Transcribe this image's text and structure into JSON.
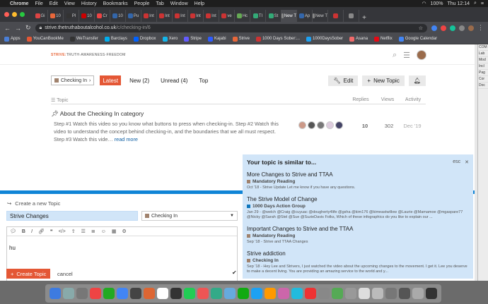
{
  "menubar": {
    "app": "Chrome",
    "items": [
      "File",
      "Edit",
      "View",
      "History",
      "Bookmarks",
      "People",
      "Tab",
      "Window",
      "Help"
    ],
    "battery": "100%",
    "clock": "Thu 12:14"
  },
  "tabs": [
    {
      "label": "Gi",
      "color": "#d44"
    },
    {
      "label": "10",
      "color": "#e8673a"
    },
    {
      "label": "Pl",
      "color": "#333"
    },
    {
      "label": "10",
      "color": "#c00"
    },
    {
      "label": "Cr",
      "color": "#e44"
    },
    {
      "label": "10",
      "color": "#36a"
    },
    {
      "label": "Pu",
      "color": "#36a"
    },
    {
      "label": "Int",
      "color": "#c33"
    },
    {
      "label": "Int",
      "color": "#c33"
    },
    {
      "label": "Int",
      "color": "#c33"
    },
    {
      "label": "Int",
      "color": "#c33"
    },
    {
      "label": "Int",
      "color": "#c33"
    },
    {
      "label": "ve",
      "color": "#c33"
    },
    {
      "label": "Hc",
      "color": "#6a5"
    },
    {
      "label": "TI",
      "color": "#3a7"
    },
    {
      "label": "St",
      "color": "#3a7"
    },
    {
      "label": "New T",
      "color": "#888"
    },
    {
      "label": "Ap",
      "color": "#36a"
    },
    {
      "label": "New T",
      "color": "#888"
    },
    {
      "label": "",
      "color": "#c33"
    },
    {
      "label": "",
      "color": "#888"
    }
  ],
  "address": {
    "domain": "strive.thetruthaboutalcohol.co.uk",
    "path": "/c/checking-in/6"
  },
  "bookmarks": [
    {
      "label": "Apps",
      "color": "#4a7fd8"
    },
    {
      "label": "YouCanBookMe",
      "color": "#e45735"
    },
    {
      "label": "WeTransfer",
      "color": "#333"
    },
    {
      "label": "Barclays",
      "color": "#00aeef"
    },
    {
      "label": "Dropbox",
      "color": "#0061ff"
    },
    {
      "label": "Xero",
      "color": "#13b5ea"
    },
    {
      "label": "Stripe",
      "color": "#635bff"
    },
    {
      "label": "Kajabi",
      "color": "#2d5bff"
    },
    {
      "label": "Strive",
      "color": "#e8673a"
    },
    {
      "label": "1000 Days Sober:...",
      "color": "#c33"
    },
    {
      "label": "1000DaysSober",
      "color": "#1da1f2"
    },
    {
      "label": "Asana",
      "color": "#f06a6a"
    },
    {
      "label": "Netflix",
      "color": "#e50914"
    },
    {
      "label": "Google Calendar",
      "color": "#4285f4"
    }
  ],
  "site": {
    "logo_brand": "STRIVE:",
    "logo_rest": "TRUTH·AWARENESS·FREEDOM"
  },
  "nav": {
    "category": "Checking In",
    "links": [
      "Latest",
      "New (2)",
      "Unread (4)",
      "Top"
    ],
    "edit_label": "Edit",
    "new_topic_label": "New Topic"
  },
  "table": {
    "headers": {
      "topic": "Topic",
      "replies": "Replies",
      "views": "Views",
      "activity": "Activity"
    },
    "row": {
      "title": "About the Checking In category",
      "excerpt": "Step #1 Watch this video so you know what buttons to press when checking-in. Step #2 Watch this video to understand the concept behind checking-in, and the boundaries that we all must respect. Step #3 Watch this vide…",
      "read_more": "read more",
      "replies": "10",
      "views": "302",
      "activity": "Dec '19"
    }
  },
  "composer": {
    "header": "Create a new Topic",
    "title_value": "Strive Changes",
    "category": "Checking In",
    "body": "hu",
    "create_label": "Create Topic",
    "cancel_label": "cancel"
  },
  "similar": {
    "heading": "Your topic is similar to...",
    "esc": "esc",
    "items": [
      {
        "title": "More Changes to Strive and TTAA",
        "category": "Mandatory Reading",
        "cat_color": "#a0826d",
        "excerpt": "Oct '18 - Strive Update Let me know if you have any questions."
      },
      {
        "title": "The Strive Model of Change",
        "category": "1000 Days Action Group",
        "cat_color": "#0e76bd",
        "excerpt": "Jan 29 - @welch @Craig @cuyuac @dougherty4life @gsha @kim176 @kimeastwillow @Laurie @Mamamoe @mgaspare77 @Nicky @Sarah @Stel @Sue @SuzieDavis Folks, Which of these infographics do you like to explain our ..."
      },
      {
        "title": "Important Changes to Strive and the TTAA",
        "category": "Mandatory Reading",
        "cat_color": "#a0826d",
        "excerpt": "Sep '18 - Strive and TTAA Changes"
      },
      {
        "title": "Strive addiction",
        "category": "Checking In",
        "cat_color": "#a0826d",
        "excerpt": "Sep '18 - Hey Lee and Strivers, I just watched the video about the upcoming changes to the movement. I get it. Lee you deserve to make a decent living. You are providing an amazing service to the world and y..."
      }
    ]
  },
  "sidewin": [
    "COM",
    "Lab",
    "Mod",
    "Incl",
    "Pag",
    "Cor",
    "Doc"
  ],
  "dock_colors": [
    "#3d7be0",
    "#8aa",
    "#777",
    "#e44",
    "#2a2",
    "#4285f4",
    "#444",
    "#d63",
    "#fff",
    "#333",
    "#2c5",
    "#e55",
    "#3a8",
    "#6ad",
    "#1a1",
    "#1da1f2",
    "#f90",
    "#c6a",
    "#2bd",
    "#e33",
    "#888",
    "#5a5",
    "#999",
    "#ddd",
    "#bbb",
    "#777",
    "#555",
    "#aaa",
    "#333"
  ]
}
